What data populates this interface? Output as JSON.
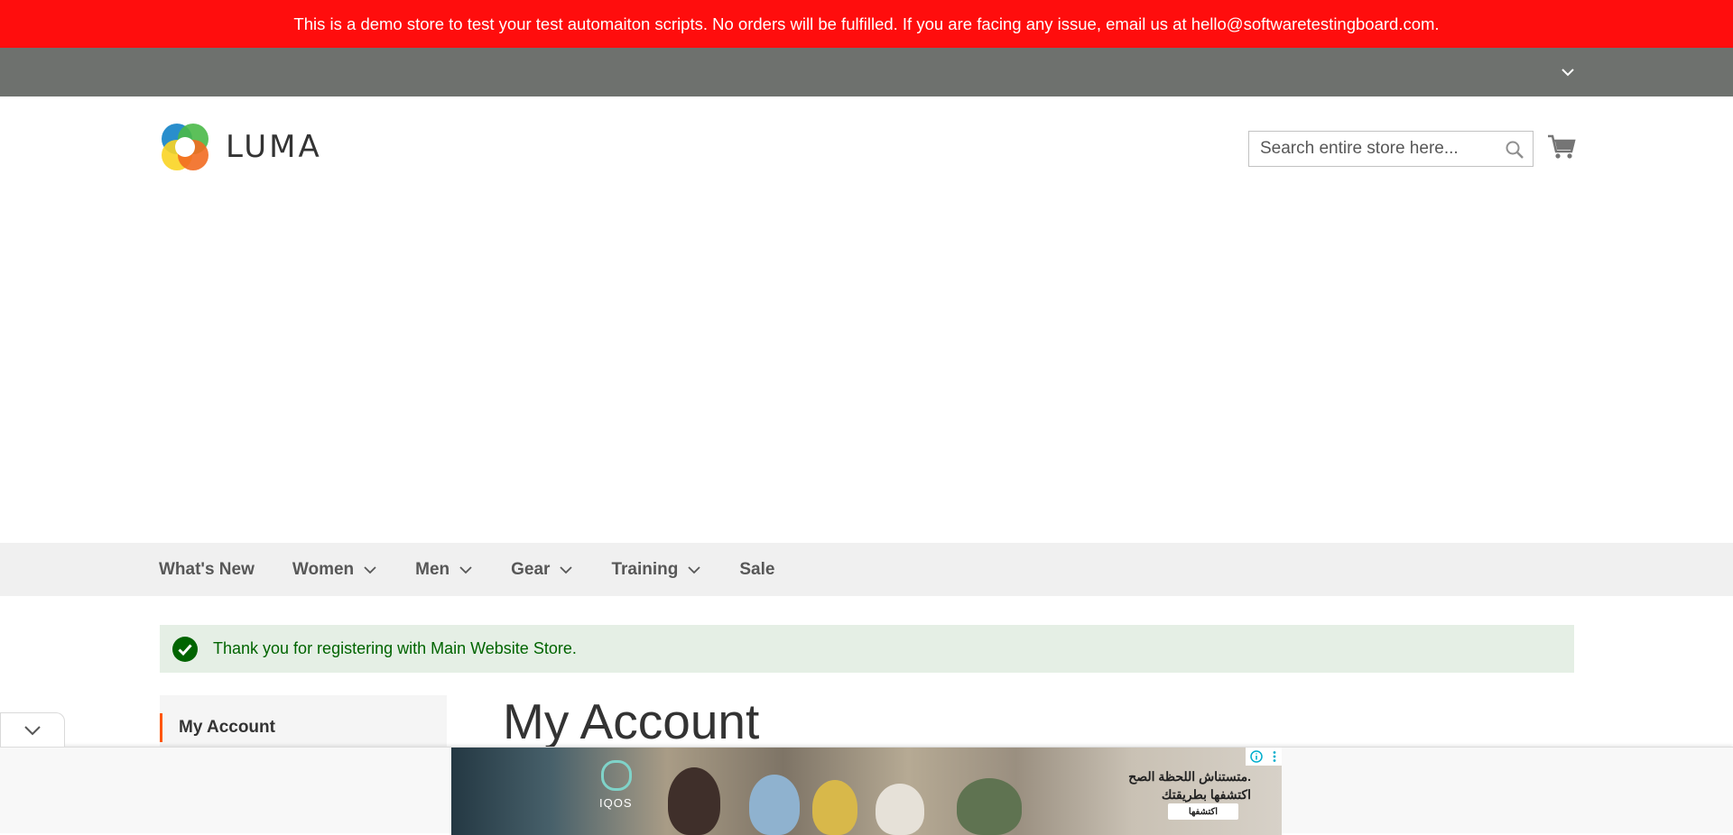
{
  "notice": {
    "text": "This is a demo store to test your test automaiton scripts. No orders will be fulfilled. If you are facing any issue, email us at hello@softwaretestingboard.com."
  },
  "header": {
    "logo_text": "LUMA",
    "search": {
      "placeholder": "Search entire store here..."
    }
  },
  "nav": {
    "items": [
      {
        "label": "What's New",
        "has_dropdown": false
      },
      {
        "label": "Women",
        "has_dropdown": true
      },
      {
        "label": "Men",
        "has_dropdown": true
      },
      {
        "label": "Gear",
        "has_dropdown": true
      },
      {
        "label": "Training",
        "has_dropdown": true
      },
      {
        "label": "Sale",
        "has_dropdown": false
      }
    ]
  },
  "message": {
    "text": "Thank you for registering with Main Website Store.",
    "type": "success"
  },
  "sidebar": {
    "active_item": "My Account"
  },
  "main": {
    "page_title": "My Account"
  },
  "ad": {
    "brand": "IQOS",
    "headline_line1": "متستناش اللحظة الصح.",
    "headline_line2": "اكتشفها بطريقتك",
    "cta": "اكتشفها"
  },
  "colors": {
    "notice_bg": "#ff0d0d",
    "panel_bg": "#6e716e",
    "nav_bg": "#f0f0f0",
    "success_bg": "#e5efe5",
    "success_text": "#006400",
    "accent": "#ff5501"
  }
}
